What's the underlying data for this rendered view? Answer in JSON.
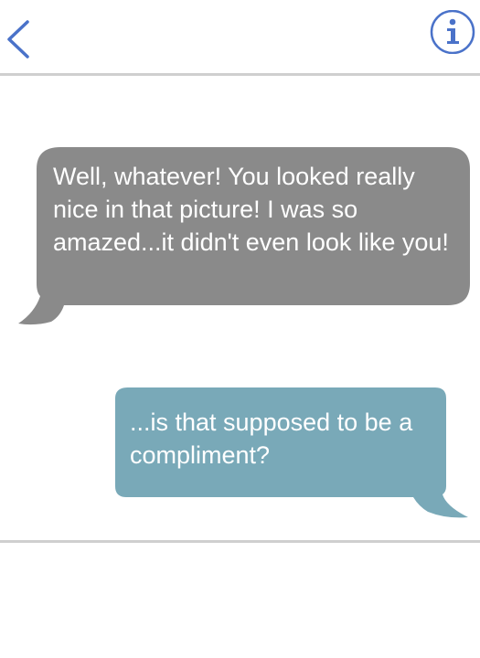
{
  "header": {
    "back_icon": "chevron-left-icon",
    "info_icon": "info-icon",
    "accent_color": "#4a72c9"
  },
  "conversation": {
    "messages": [
      {
        "direction": "received",
        "text": "Well, whatever! You looked really nice in that picture! I was so amazed...it didn't even look like you!",
        "color": "#8a8a8a"
      },
      {
        "direction": "sent",
        "text": "...is that supposed to be a compliment?",
        "color": "#79a9b8"
      }
    ]
  },
  "colors": {
    "divider": "#cfcfcf",
    "text_on_bubble": "#ffffff",
    "background": "#ffffff"
  }
}
